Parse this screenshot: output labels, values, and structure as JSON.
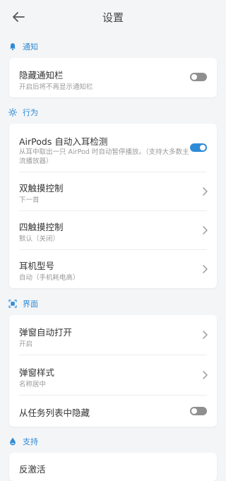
{
  "header": {
    "title": "设置",
    "back_icon": "arrow-left-icon"
  },
  "accent_color": "#2f8bd6",
  "sections": {
    "notify": {
      "title": "通知",
      "icon": "bell-icon",
      "hide_notification": {
        "title": "隐藏通知栏",
        "subtitle": "开启后将不再显示通知栏",
        "enabled": false
      }
    },
    "behavior": {
      "title": "行为",
      "icon": "sun-icon",
      "airpods_detect": {
        "title": "AirPods 自动入耳检测",
        "subtitle": "从耳中取出一只 AirPod 时自动暂停播放。（支持大多数主流播放器）",
        "enabled": true
      },
      "double_tap": {
        "title": "双触摸控制",
        "subtitle": "下一首"
      },
      "quad_tap": {
        "title": "四触摸控制",
        "subtitle": "默认（关闭）"
      },
      "earphone_model": {
        "title": "耳机型号",
        "subtitle": "自动（手机耗电高）"
      }
    },
    "ui": {
      "title": "界面",
      "icon": "frame-icon",
      "popup_auto_open": {
        "title": "弹窗自动打开",
        "subtitle": "开启"
      },
      "popup_style": {
        "title": "弹窗样式",
        "subtitle": "名称居中"
      },
      "hide_from_recents": {
        "title": "从任务列表中隐藏",
        "enabled": false
      }
    },
    "support": {
      "title": "支持",
      "icon": "drop-icon",
      "deactivate": {
        "title": "反激活"
      }
    }
  }
}
